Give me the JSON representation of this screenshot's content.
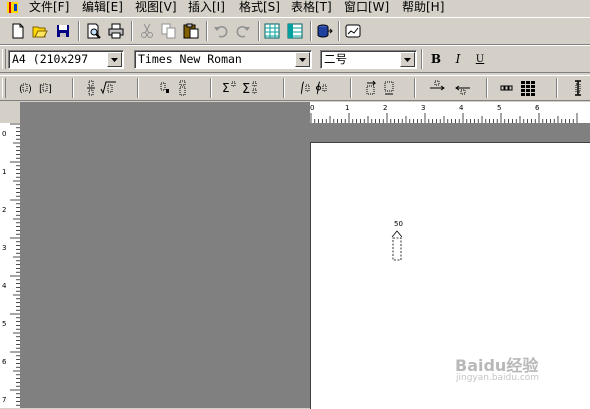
{
  "menu": {
    "items": [
      {
        "label": "文件[F]"
      },
      {
        "label": "编辑[E]"
      },
      {
        "label": "视图[V]"
      },
      {
        "label": "插入[I]"
      },
      {
        "label": "格式[S]"
      },
      {
        "label": "表格[T]"
      },
      {
        "label": "窗口[W]"
      },
      {
        "label": "帮助[H]"
      }
    ]
  },
  "format_bar": {
    "paper_size": "A4  (210x297",
    "font_name": "Times New Roman",
    "font_size": "二号",
    "bold_label": "B",
    "italic_label": "I",
    "underline_label": "U"
  },
  "ruler": {
    "h_labels": [
      "0",
      "1",
      "2",
      "3",
      "4",
      "5",
      "6"
    ],
    "v_labels": [
      "0",
      "1",
      "2",
      "3",
      "4",
      "5",
      "6",
      "7"
    ]
  },
  "document": {
    "cursor_label": "50"
  },
  "watermark": {
    "text": "Baidu经验",
    "url": "jingyan.baidu.com"
  }
}
